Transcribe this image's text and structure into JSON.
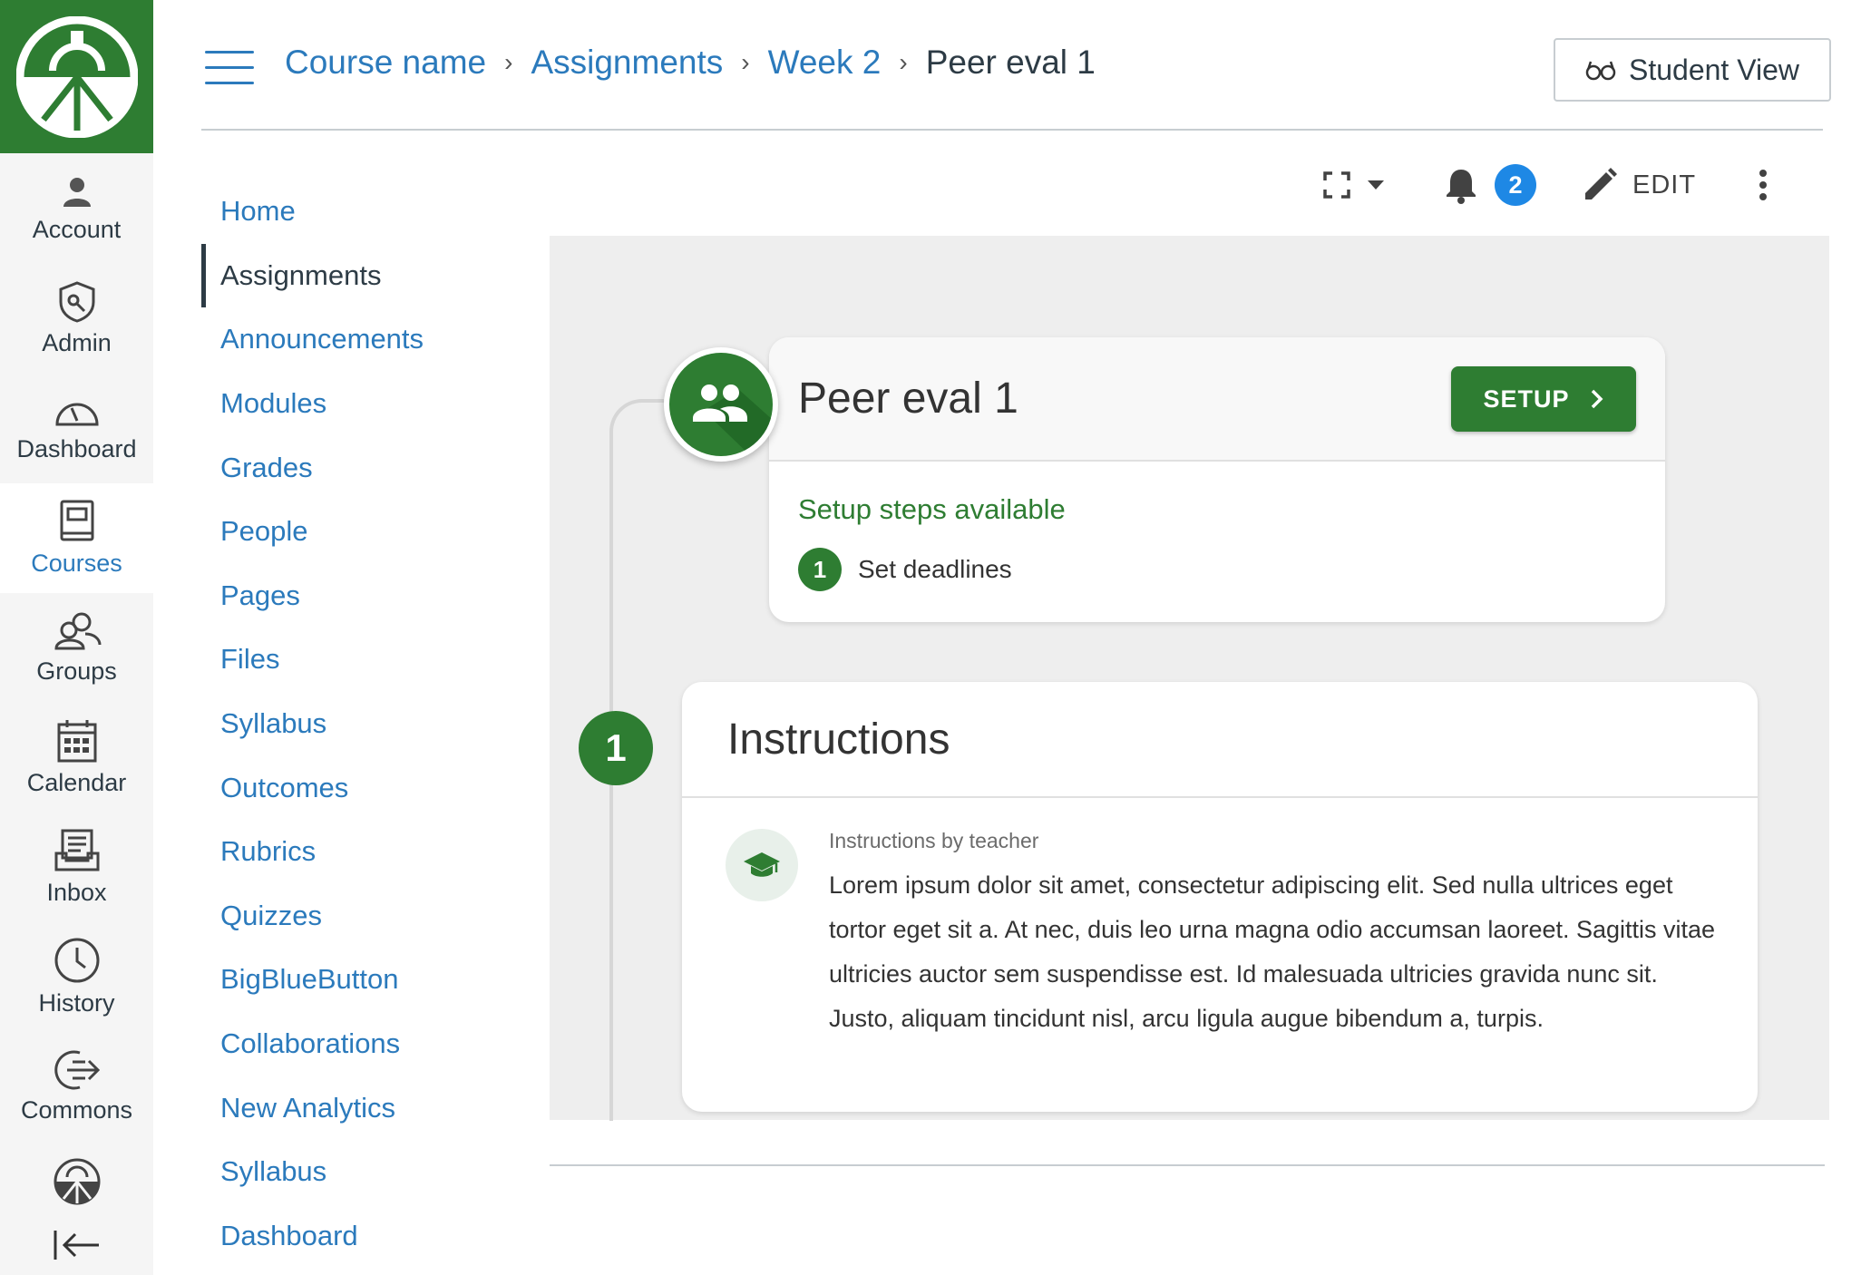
{
  "global_nav": {
    "items": [
      {
        "label": "Account",
        "icon": "account-icon"
      },
      {
        "label": "Admin",
        "icon": "admin-icon"
      },
      {
        "label": "Dashboard",
        "icon": "dashboard-icon"
      },
      {
        "label": "Courses",
        "icon": "courses-icon",
        "active": true
      },
      {
        "label": "Groups",
        "icon": "groups-icon"
      },
      {
        "label": "Calendar",
        "icon": "calendar-icon"
      },
      {
        "label": "Inbox",
        "icon": "inbox-icon"
      },
      {
        "label": "History",
        "icon": "history-icon"
      },
      {
        "label": "Commons",
        "icon": "commons-icon"
      }
    ],
    "brand_color": "#2E7D32"
  },
  "breadcrumb": {
    "items": [
      "Course name",
      "Assignments",
      "Week 2"
    ],
    "current": "Peer eval 1"
  },
  "header": {
    "student_view_label": "Student View"
  },
  "course_nav": {
    "items": [
      {
        "label": "Home"
      },
      {
        "label": "Assignments",
        "active": true
      },
      {
        "label": "Announcements"
      },
      {
        "label": "Modules"
      },
      {
        "label": "Grades"
      },
      {
        "label": "People"
      },
      {
        "label": "Pages"
      },
      {
        "label": "Files"
      },
      {
        "label": "Syllabus"
      },
      {
        "label": "Outcomes"
      },
      {
        "label": "Rubrics"
      },
      {
        "label": "Quizzes"
      },
      {
        "label": "BigBlueButton"
      },
      {
        "label": "Collaborations"
      },
      {
        "label": "New Analytics"
      },
      {
        "label": "Syllabus"
      },
      {
        "label": "Dashboard"
      }
    ]
  },
  "toolbar": {
    "notification_count": "2",
    "edit_label": "EDIT"
  },
  "assignment": {
    "title": "Peer eval 1",
    "setup_label": "SETUP",
    "setup_status": "Setup steps available",
    "steps": [
      {
        "number": "1",
        "label": "Set deadlines"
      }
    ]
  },
  "instructions": {
    "section_number": "1",
    "title": "Instructions",
    "byline": "Instructions by teacher",
    "body": "Lorem ipsum dolor sit amet, consectetur adipiscing elit. Sed nulla ultrices eget tortor eget sit a. At nec, duis leo urna magna odio accumsan laoreet. Sagittis vitae ultricies auctor sem suspendisse est. Id malesuada ultricies gravida nunc sit. Justo, aliquam tincidunt nisl, arcu ligula augue bibendum a, turpis."
  },
  "colors": {
    "accent": "#2E7D32",
    "link": "#2B7ABC",
    "badge": "#1E88E5"
  }
}
